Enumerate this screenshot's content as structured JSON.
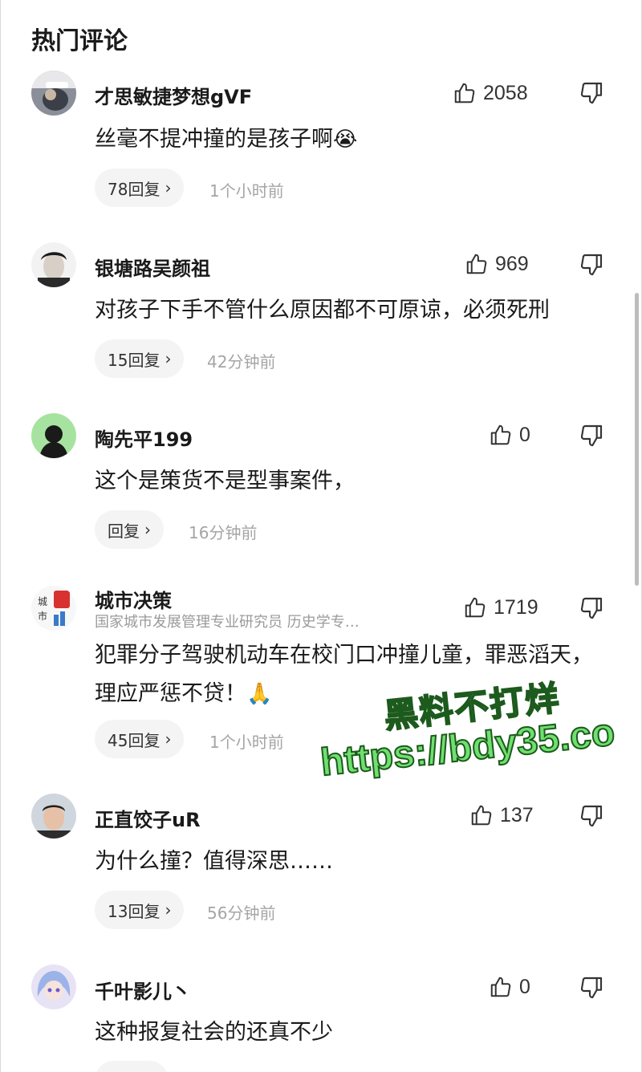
{
  "header": {
    "title": "热门评论"
  },
  "comments": [
    {
      "username": "才思敏捷梦想gVF",
      "subtitle": "",
      "likes": "2058",
      "text": "丝毫不提冲撞的是孩子啊",
      "emoji": "😭",
      "replies": "78回复",
      "time": "1个小时前"
    },
    {
      "username": "银塘路吴颜祖",
      "subtitle": "",
      "likes": "969",
      "text": "对孩子下手不管什么原因都不可原谅，必须死刑",
      "emoji": "",
      "replies": "15回复",
      "time": "42分钟前"
    },
    {
      "username": "陶先平199",
      "subtitle": "",
      "likes": "0",
      "text": "这个是策货不是型事案件，",
      "emoji": "",
      "replies": "回复",
      "time": "16分钟前"
    },
    {
      "username": "城市决策",
      "subtitle": "国家城市发展管理专业研究员 历史学专…",
      "likes": "1719",
      "text": "犯罪分子驾驶机动车在校门口冲撞儿童，罪恶滔天，理应严惩不贷！",
      "emoji": "🙏",
      "replies": "45回复",
      "time": "1个小时前"
    },
    {
      "username": "正直饺子uR",
      "subtitle": "",
      "likes": "137",
      "text": "为什么撞？值得深思……",
      "emoji": "",
      "replies": "13回复",
      "time": "56分钟前"
    },
    {
      "username": "千叶影儿丶",
      "subtitle": "",
      "likes": "0",
      "text": "这种报复社会的还真不少",
      "emoji": "",
      "replies": "",
      "time": ""
    }
  ],
  "watermark": {
    "line1": "黑料不打烊",
    "line2": "https://bdy35.co"
  },
  "icons": {
    "like": "thumbs-up-icon",
    "dislike": "thumbs-down-icon",
    "reply_chevron": "chevron-right-icon"
  },
  "colors": {
    "accent_green": "#6fe06f",
    "muted": "#9a9a9a",
    "pill_bg": "#f4f4f4"
  }
}
